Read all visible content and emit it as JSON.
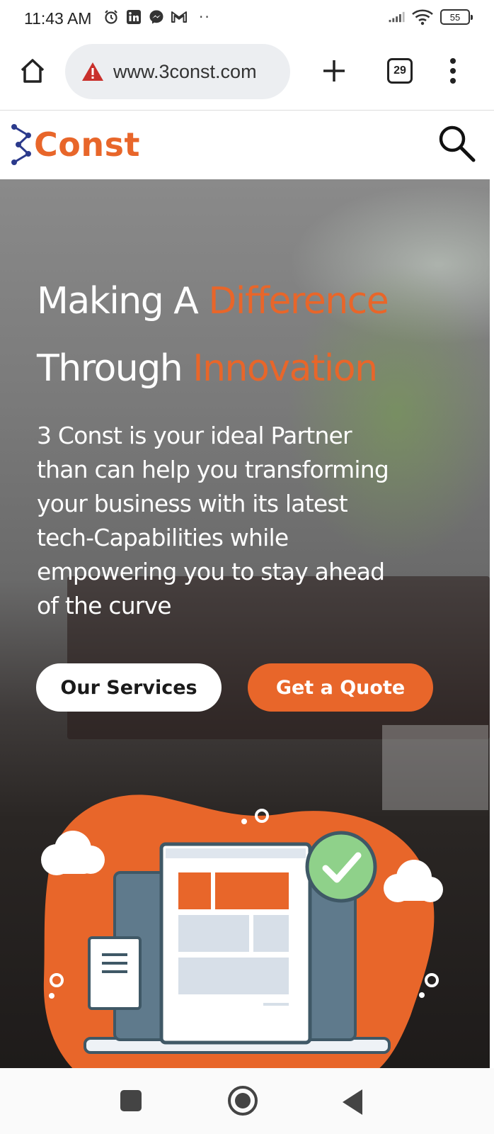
{
  "status_bar": {
    "time": "11:43 AM",
    "icons": [
      "alarm-icon",
      "linkedin-icon",
      "messenger-icon",
      "gmail-icon"
    ],
    "more": "··",
    "battery": "55"
  },
  "browser": {
    "url": "www.3const.com",
    "tab_count": "29"
  },
  "site": {
    "logo_text": "Const",
    "brand_color": "#e8662a"
  },
  "hero": {
    "title_line1_white": "Making A ",
    "title_line1_accent": "Difference",
    "title_line2_white": "Through ",
    "title_line2_accent": "Innovation",
    "description": "3 Const is your ideal Partner than can help you transforming your business with its latest tech-Capabilities while empowering you to stay ahead of the curve",
    "primary_button": "Our Services",
    "secondary_button": "Get a Quote"
  },
  "colors": {
    "accent": "#e8662a",
    "check_green": "#8fd18a",
    "device_blue": "#5f7a8c"
  }
}
